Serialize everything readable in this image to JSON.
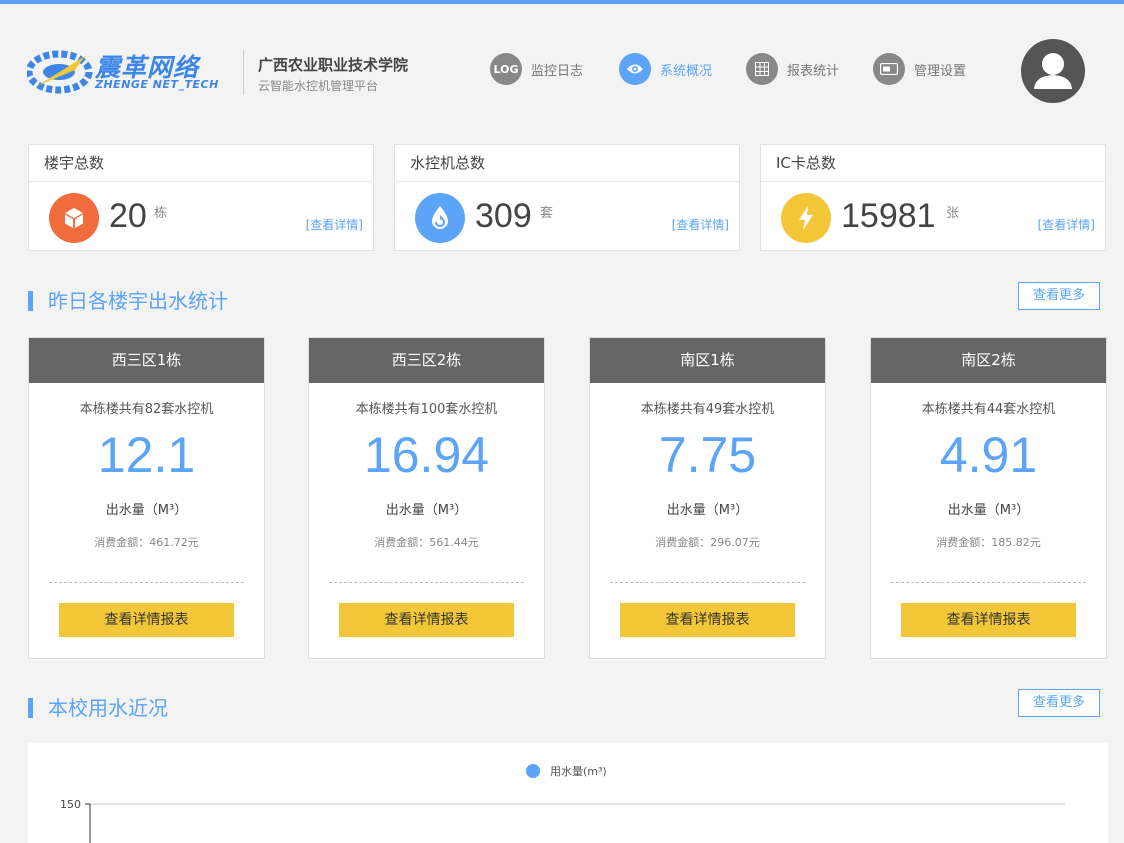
{
  "header": {
    "logo_text": "震革网络",
    "logo_sub": "ZHENGE NET_TECH",
    "school_name": "广西农业职业技术学院",
    "platform_name": "云智能水控机管理平台",
    "accent_color": "#5ba4f7"
  },
  "nav": [
    {
      "label": "监控日志",
      "icon": "log-icon",
      "icon_text": "LOG",
      "active": false
    },
    {
      "label": "系统概况",
      "icon": "eye-icon",
      "active": true
    },
    {
      "label": "报表统计",
      "icon": "grid-icon",
      "active": false
    },
    {
      "label": "管理设置",
      "icon": "card-icon",
      "active": false
    }
  ],
  "stats": [
    {
      "title": "楼宇总数",
      "value": "20",
      "unit": "栋",
      "link": "[查看详情]",
      "icon": "cube-icon",
      "color": "#f26d3d"
    },
    {
      "title": "水控机总数",
      "value": "309",
      "unit": "套",
      "link": "[查看详情]",
      "icon": "water-drop-icon",
      "color": "#5ba4f7"
    },
    {
      "title": "IC卡总数",
      "value": "15981",
      "unit": "张",
      "link": "[查看详情]",
      "icon": "lightning-icon",
      "color": "#f3c737"
    }
  ],
  "section1": {
    "title": "昨日各楼宇出水统计",
    "more": "查看更多"
  },
  "buildings": [
    {
      "name": "西三区1栋",
      "count": "本栋楼共有82套水控机",
      "value": "12.1",
      "label": "出水量（M³）",
      "cost": "消费金额：461.72元",
      "button": "查看详情报表"
    },
    {
      "name": "西三区2栋",
      "count": "本栋楼共有100套水控机",
      "value": "16.94",
      "label": "出水量（M³）",
      "cost": "消费金额：561.44元",
      "button": "查看详情报表"
    },
    {
      "name": "南区1栋",
      "count": "本栋楼共有49套水控机",
      "value": "7.75",
      "label": "出水量（M³）",
      "cost": "消费金额：296.07元",
      "button": "查看详情报表"
    },
    {
      "name": "南区2栋",
      "count": "本栋楼共有44套水控机",
      "value": "4.91",
      "label": "出水量（M³）",
      "cost": "消费金额：185.82元",
      "button": "查看详情报表"
    }
  ],
  "section2": {
    "title": "本校用水近况",
    "more": "查看更多"
  },
  "chart": {
    "legend": "用水量(m³)",
    "series_color": "#5ba4f7",
    "y_tick": "150"
  }
}
